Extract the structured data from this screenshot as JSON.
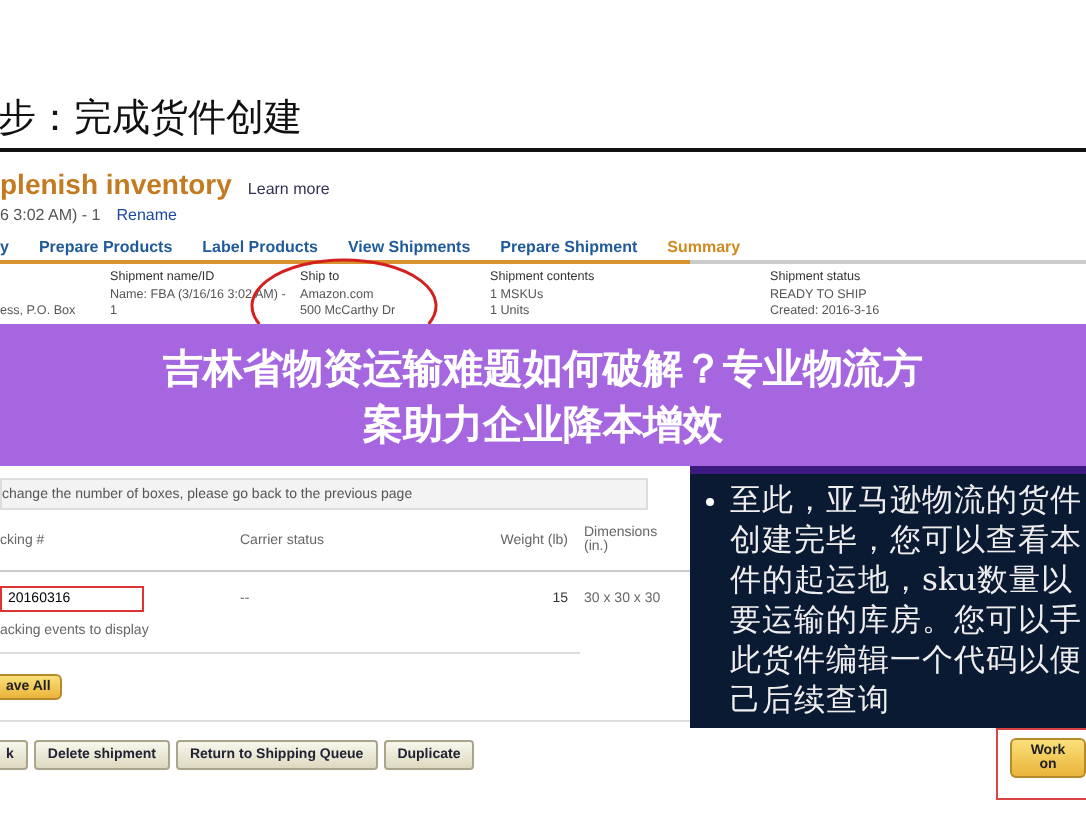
{
  "slide_heading": "步：完成货件创建",
  "page": {
    "title": "plenish inventory",
    "learn_more": "Learn more",
    "subtitle": "6 3:02 AM) - 1",
    "rename": "Rename",
    "tabs": [
      {
        "label": "y",
        "selected": false
      },
      {
        "label": "Prepare Products",
        "selected": false
      },
      {
        "label": "Label Products",
        "selected": false
      },
      {
        "label": "View Shipments",
        "selected": false
      },
      {
        "label": "Prepare Shipment",
        "selected": false
      },
      {
        "label": "Summary",
        "selected": true
      }
    ],
    "summary_columns": [
      {
        "lines": [
          "ess, P.O. Box"
        ]
      },
      {
        "heading": "Shipment name/ID",
        "lines": [
          "Name: FBA (3/16/16 3:02 AM) -",
          "1"
        ]
      },
      {
        "heading": "Ship to",
        "lines": [
          "Amazon.com",
          "500 McCarthy Dr"
        ]
      },
      {
        "heading": "Shipment contents",
        "lines": [
          "1 MSKUs",
          "1 Units"
        ]
      },
      {
        "heading": "Shipment status",
        "lines": [
          "READY TO SHIP",
          "Created: 2016-3-16"
        ]
      }
    ],
    "notice": "change the number of boxes, please go back to the previous page",
    "box_table": {
      "columns": [
        "cking #",
        "Carrier status",
        "Weight (lb)",
        "Dimensions (in.)"
      ],
      "row": {
        "tracking": "20160316",
        "carrier_status": "--",
        "weight": "15",
        "dimensions": "30 x 30 x 30"
      },
      "note": "acking events to display"
    },
    "save_button": "ave All",
    "buttons": [
      "k",
      "Delete shipment",
      "Return to Shipping Queue",
      "Duplicate"
    ],
    "work_on_button": "Work on"
  },
  "banner_lines": [
    "吉林省物资运输难题如何破解？专业物流方",
    "案助力企业降本增效"
  ],
  "callout_lines": [
    "至此，亚马逊物流的货件",
    "创建完毕，您可以查看本",
    "件的起运地，sku数量以",
    "要运输的库房。您可以手",
    "此货件编辑一个代码以便",
    "己后续查询"
  ]
}
